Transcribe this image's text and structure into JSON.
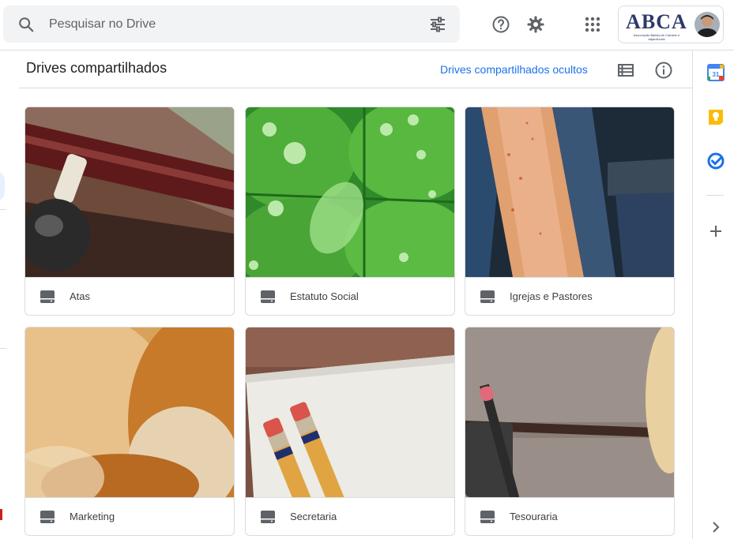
{
  "search": {
    "placeholder": "Pesquisar no Drive"
  },
  "account": {
    "logo_text": "ABCA",
    "logo_subtitle": "Associação Batista do Calvário e Adjacências"
  },
  "page": {
    "title": "Drives compartilhados",
    "hidden_drives_link": "Drives compartilhados ocultos"
  },
  "drives": [
    {
      "name": "Atas",
      "thumb": "wood-knob"
    },
    {
      "name": "Estatuto Social",
      "thumb": "clover-drops"
    },
    {
      "name": "Igrejas e Pastores",
      "thumb": "books"
    },
    {
      "name": "Marketing",
      "thumb": "bread"
    },
    {
      "name": "Secretaria",
      "thumb": "pencils"
    },
    {
      "name": "Tesouraria",
      "thumb": "desk"
    }
  ],
  "side_panel": {
    "calendar_day": "31",
    "apps": [
      "calendar-icon",
      "keep-icon",
      "tasks-icon",
      "add-icon",
      "chevron-right-icon"
    ]
  },
  "colors": {
    "accent": "#1a73e8",
    "search_bg": "#f1f3f4",
    "border": "#dadce0",
    "text_primary": "#202124",
    "text_secondary": "#5f6368"
  }
}
